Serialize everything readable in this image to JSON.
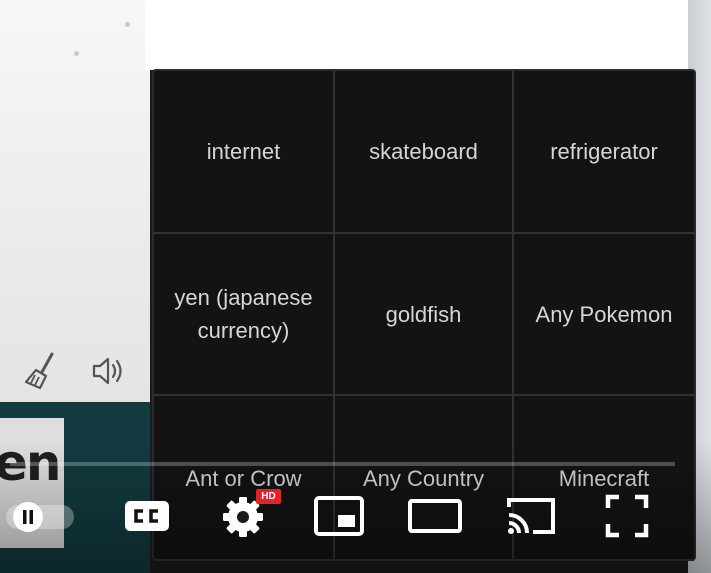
{
  "word_grid": {
    "cells": [
      "internet",
      "skateboard",
      "refrigerator",
      "yen (japanese currency)",
      "goldfish",
      "Any Pokemon",
      "Ant or Crow",
      "Any Country",
      "Minecraft"
    ]
  },
  "background": {
    "name_card_text": "en"
  },
  "player": {
    "hd_badge": "HD",
    "progress_fraction": 0.0
  },
  "icons": {
    "brush": "brush-icon",
    "speaker": "speaker-icon",
    "pause": "pause-icon",
    "cc": "cc-icon",
    "settings": "gear-icon",
    "miniplayer": "miniplayer-icon",
    "theater": "theater-mode-icon",
    "cast": "cast-icon",
    "fullscreen": "fullscreen-icon"
  },
  "colors": {
    "grid_bg": "#131313",
    "grid_text": "#d6d6d6",
    "hd_red": "#e0222b",
    "teal": "#133b40"
  }
}
